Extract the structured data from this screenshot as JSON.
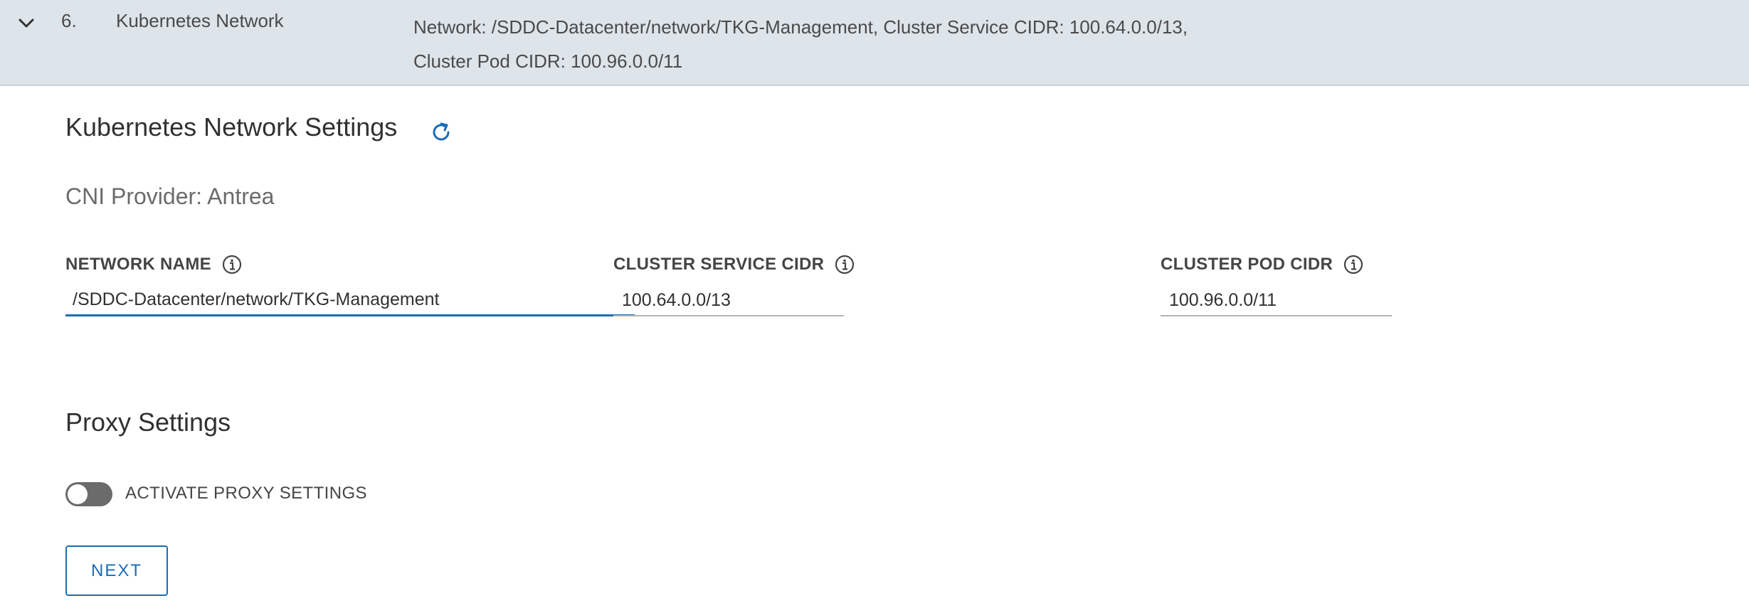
{
  "step_header": {
    "number": "6.",
    "title": "Kubernetes Network",
    "summary_line1": "Network: /SDDC-Datacenter/network/TKG-Management, Cluster Service CIDR: 100.64.0.0/13,",
    "summary_line2": "Cluster Pod CIDR: 100.96.0.0/11",
    "chevron_icon": "chevron-down-icon"
  },
  "network_settings": {
    "title": "Kubernetes Network Settings",
    "refresh_icon": "refresh-icon",
    "cni_provider": "CNI Provider: Antrea"
  },
  "fields": {
    "network_name": {
      "label": "NETWORK NAME",
      "value": "/SDDC-Datacenter/network/TKG-Management",
      "info_icon": "info-icon"
    },
    "cluster_service_cidr": {
      "label": "CLUSTER SERVICE CIDR",
      "value": "100.64.0.0/13",
      "info_icon": "info-icon"
    },
    "cluster_pod_cidr": {
      "label": "CLUSTER POD CIDR",
      "value": "100.96.0.0/11",
      "info_icon": "info-icon"
    }
  },
  "proxy_settings": {
    "title": "Proxy Settings",
    "toggle_label": "ACTIVATE PROXY SETTINGS",
    "toggle_on": false
  },
  "actions": {
    "next_label": "NEXT"
  },
  "colors": {
    "accent": "#1b6db6",
    "header_bg": "#dde4ea",
    "toggle_off": "#6b6b6b"
  }
}
